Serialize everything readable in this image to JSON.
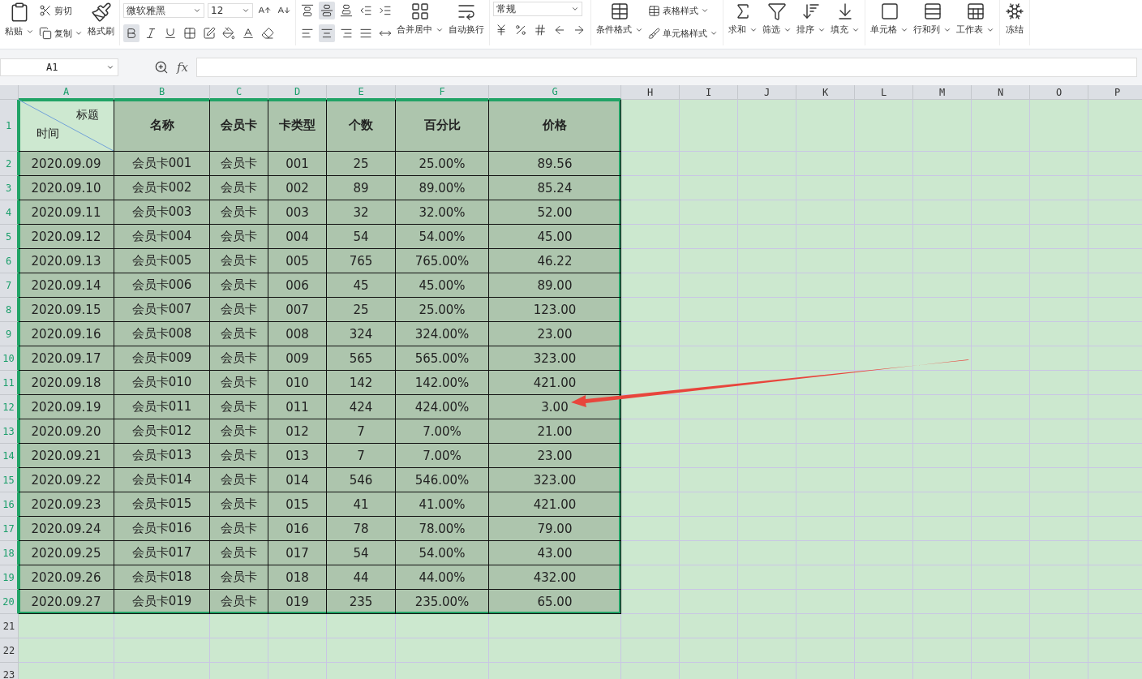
{
  "ribbon": {
    "clipboard": {
      "paste": "粘贴",
      "cut": "剪切",
      "copy": "复制",
      "format_painter": "格式刷"
    },
    "font": {
      "name": "微软雅黑",
      "size": "12",
      "buttons": [
        {
          "kind": "bold",
          "active": true
        },
        {
          "kind": "italic",
          "active": false
        },
        {
          "kind": "underline",
          "active": false
        },
        {
          "kind": "border",
          "active": false
        },
        {
          "kind": "effects",
          "active": false
        },
        {
          "kind": "fill",
          "active": false
        },
        {
          "kind": "font-color",
          "active": false
        },
        {
          "kind": "clear",
          "active": false
        }
      ]
    },
    "alignment": {
      "buttons": [
        {
          "kind": "top",
          "active": false
        },
        {
          "kind": "middle",
          "active": true
        },
        {
          "kind": "bottom",
          "active": false
        },
        {
          "kind": "outdent",
          "active": false
        },
        {
          "kind": "indent",
          "active": false
        },
        {
          "kind": "left",
          "active": false
        },
        {
          "kind": "center",
          "active": true
        },
        {
          "kind": "right",
          "active": false
        },
        {
          "kind": "justify",
          "active": false
        },
        {
          "kind": "distributed",
          "active": false
        }
      ],
      "merge": "合并居中",
      "wrap": "自动换行"
    },
    "number": {
      "format": "常规"
    },
    "styles": {
      "conditional": "条件格式",
      "table_style": "表格样式",
      "cell_style": "单元格样式"
    },
    "tools": [
      {
        "kind": "sum",
        "label": "求和"
      },
      {
        "kind": "filter",
        "label": "筛选"
      },
      {
        "kind": "sort",
        "label": "排序"
      },
      {
        "kind": "fill",
        "label": "填充"
      }
    ],
    "cells": [
      {
        "kind": "cell",
        "label": "单元格"
      },
      {
        "kind": "rows",
        "label": "行和列"
      },
      {
        "kind": "sheet",
        "label": "工作表"
      }
    ],
    "freeze": "冻结"
  },
  "formula_bar": {
    "name_box": "A1",
    "fx_label": "fx"
  },
  "columns": [
    {
      "label": "A",
      "selected": true
    },
    {
      "label": "B",
      "selected": true
    },
    {
      "label": "C",
      "selected": true
    },
    {
      "label": "D",
      "selected": true
    },
    {
      "label": "E",
      "selected": true
    },
    {
      "label": "F",
      "selected": true
    },
    {
      "label": "G",
      "selected": true
    },
    {
      "label": "H",
      "selected": false
    },
    {
      "label": "I",
      "selected": false
    },
    {
      "label": "J",
      "selected": false
    },
    {
      "label": "K",
      "selected": false
    },
    {
      "label": "L",
      "selected": false
    },
    {
      "label": "M",
      "selected": false
    },
    {
      "label": "N",
      "selected": false
    },
    {
      "label": "O",
      "selected": false
    },
    {
      "label": "P",
      "selected": false
    }
  ],
  "rows": [
    {
      "number": "1",
      "selected": true,
      "header": true,
      "corner": {
        "top_right": "标题",
        "bottom_left": "时间",
        "active": true
      },
      "cells": [
        "名称",
        "会员卡",
        "卡类型",
        "个数",
        "百分比",
        "价格"
      ]
    },
    {
      "number": "2",
      "selected": true,
      "cells": [
        "2020.09.09",
        "会员卡001",
        "会员卡",
        "001",
        "25",
        "25.00%",
        "89.56"
      ]
    },
    {
      "number": "3",
      "selected": true,
      "cells": [
        "2020.09.10",
        "会员卡002",
        "会员卡",
        "002",
        "89",
        "89.00%",
        "85.24"
      ]
    },
    {
      "number": "4",
      "selected": true,
      "cells": [
        "2020.09.11",
        "会员卡003",
        "会员卡",
        "003",
        "32",
        "32.00%",
        "52.00"
      ]
    },
    {
      "number": "5",
      "selected": true,
      "cells": [
        "2020.09.12",
        "会员卡004",
        "会员卡",
        "004",
        "54",
        "54.00%",
        "45.00"
      ]
    },
    {
      "number": "6",
      "selected": true,
      "cells": [
        "2020.09.13",
        "会员卡005",
        "会员卡",
        "005",
        "765",
        "765.00%",
        "46.22"
      ]
    },
    {
      "number": "7",
      "selected": true,
      "cells": [
        "2020.09.14",
        "会员卡006",
        "会员卡",
        "006",
        "45",
        "45.00%",
        "89.00"
      ]
    },
    {
      "number": "8",
      "selected": true,
      "cells": [
        "2020.09.15",
        "会员卡007",
        "会员卡",
        "007",
        "25",
        "25.00%",
        "123.00"
      ]
    },
    {
      "number": "9",
      "selected": true,
      "cells": [
        "2020.09.16",
        "会员卡008",
        "会员卡",
        "008",
        "324",
        "324.00%",
        "23.00"
      ]
    },
    {
      "number": "10",
      "selected": true,
      "cells": [
        "2020.09.17",
        "会员卡009",
        "会员卡",
        "009",
        "565",
        "565.00%",
        "323.00"
      ]
    },
    {
      "number": "11",
      "selected": true,
      "cells": [
        "2020.09.18",
        "会员卡010",
        "会员卡",
        "010",
        "142",
        "142.00%",
        "421.00"
      ]
    },
    {
      "number": "12",
      "selected": true,
      "cells": [
        "2020.09.19",
        "会员卡011",
        "会员卡",
        "011",
        "424",
        "424.00%",
        "3.00"
      ]
    },
    {
      "number": "13",
      "selected": true,
      "cells": [
        "2020.09.20",
        "会员卡012",
        "会员卡",
        "012",
        "7",
        "7.00%",
        "21.00"
      ]
    },
    {
      "number": "14",
      "selected": true,
      "cells": [
        "2020.09.21",
        "会员卡013",
        "会员卡",
        "013",
        "7",
        "7.00%",
        "23.00"
      ]
    },
    {
      "number": "15",
      "selected": true,
      "cells": [
        "2020.09.22",
        "会员卡014",
        "会员卡",
        "014",
        "546",
        "546.00%",
        "323.00"
      ]
    },
    {
      "number": "16",
      "selected": true,
      "cells": [
        "2020.09.23",
        "会员卡015",
        "会员卡",
        "015",
        "41",
        "41.00%",
        "421.00"
      ]
    },
    {
      "number": "17",
      "selected": true,
      "cells": [
        "2020.09.24",
        "会员卡016",
        "会员卡",
        "016",
        "78",
        "78.00%",
        "79.00"
      ]
    },
    {
      "number": "18",
      "selected": true,
      "cells": [
        "2020.09.25",
        "会员卡017",
        "会员卡",
        "017",
        "54",
        "54.00%",
        "43.00"
      ]
    },
    {
      "number": "19",
      "selected": true,
      "cells": [
        "2020.09.26",
        "会员卡018",
        "会员卡",
        "018",
        "44",
        "44.00%",
        "432.00"
      ]
    },
    {
      "number": "20",
      "selected": true,
      "cells": [
        "2020.09.27",
        "会员卡019",
        "会员卡",
        "019",
        "235",
        "235.00%",
        "65.00"
      ]
    },
    {
      "number": "21",
      "selected": false,
      "cells": []
    },
    {
      "number": "22",
      "selected": false,
      "cells": []
    },
    {
      "number": "23",
      "selected": false,
      "cells": []
    }
  ]
}
